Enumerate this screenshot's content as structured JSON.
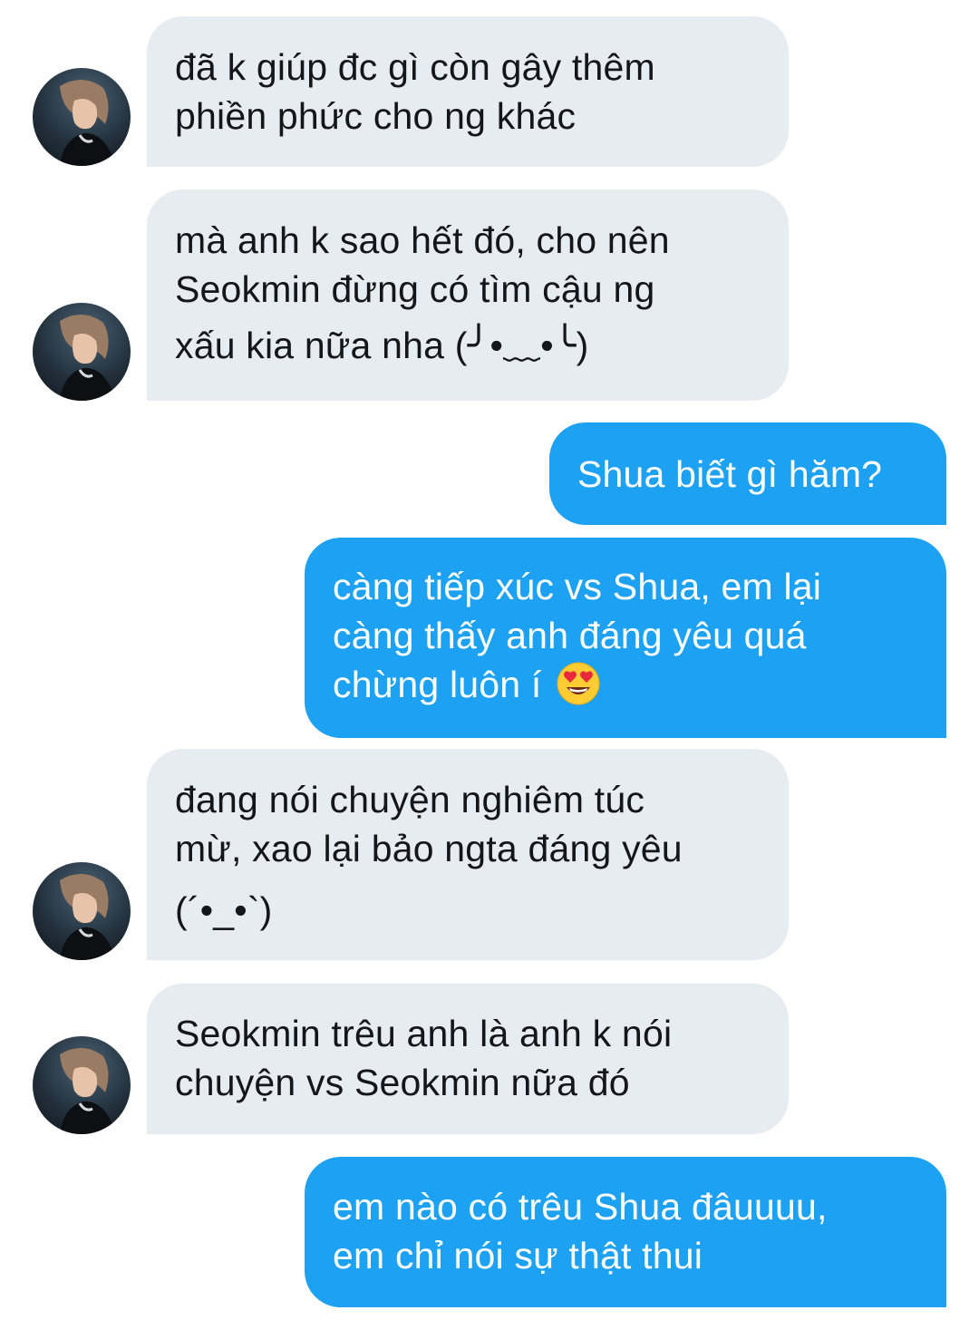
{
  "messages": [
    {
      "direction": "received",
      "lines": [
        "đã k giúp đc gì còn gây thêm",
        "phiền phức cho ng khác"
      ]
    },
    {
      "direction": "received",
      "lines": [
        "mà anh k sao hết đó, cho nên",
        "Seokmin đừng có tìm cậu ng",
        "xấu kia nữa nha (╯•﹏•╰)"
      ]
    },
    {
      "direction": "sent",
      "lines": [
        "Shua biết gì hăm?"
      ]
    },
    {
      "direction": "sent",
      "lines": [
        "càng tiếp xúc vs Shua, em lại",
        "càng thấy anh đáng yêu quá",
        "chừng luôn í"
      ],
      "emoji": "smiling-face-with-heart-eyes"
    },
    {
      "direction": "received",
      "lines": [
        "đang nói chuyện nghiêm túc",
        "mừ, xao lại bảo ngta đáng yêu",
        "(´•_•`)"
      ]
    },
    {
      "direction": "received",
      "lines": [
        "Seokmin trêu anh là anh k nói",
        "chuyện vs Seokmin nữa đó"
      ]
    },
    {
      "direction": "sent",
      "lines": [
        "em nào có trêu Shua đâuuuu,",
        "em chỉ nói sự thật thui"
      ]
    }
  ],
  "colors": {
    "received_bubble": "#e6ecf0",
    "received_text": "#14171a",
    "sent_bubble": "#1da1f2",
    "sent_text": "#ffffff"
  }
}
